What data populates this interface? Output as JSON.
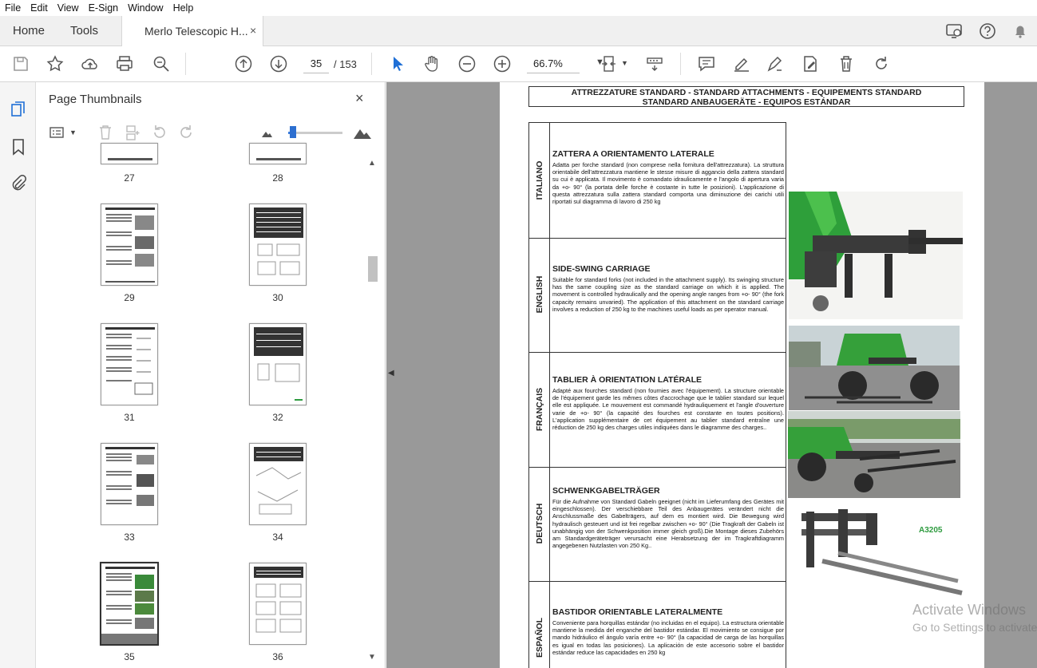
{
  "menu": [
    "File",
    "Edit",
    "View",
    "E-Sign",
    "Window",
    "Help"
  ],
  "tabs": {
    "home": "Home",
    "tools": "Tools",
    "document": "Merlo Telescopic H...",
    "close": "×"
  },
  "toolbar": {
    "page_current": "35",
    "page_total": "/ 153",
    "zoom": "66.7%"
  },
  "panel": {
    "title": "Page Thumbnails",
    "close": "×",
    "thumbnails": [
      {
        "num": "27"
      },
      {
        "num": "28"
      },
      {
        "num": "29"
      },
      {
        "num": "30"
      },
      {
        "num": "31"
      },
      {
        "num": "32"
      },
      {
        "num": "33"
      },
      {
        "num": "34"
      },
      {
        "num": "35",
        "selected": true
      },
      {
        "num": "36"
      }
    ]
  },
  "document": {
    "header_line1": "ATTREZZATURE STANDARD - STANDARD ATTACHMENTS - EQUIPEMENTS STANDARD",
    "header_line2": "STANDARD ANBAUGERÄTE - EQUIPOS ESTÁNDAR",
    "sections": [
      {
        "lang": "ITALIANO",
        "title": "ZATTERA A ORIENTAMENTO LATERALE",
        "body": "Adatta per forche standard (non comprese nella fornitura dell'attrezzatura). La struttura orientabile dell'attrezzatura mantiene le stesse misure di aggancio della zattera standard su cui è applicata. Il movimento è comandato idraulicamente e l'angolo di apertura varia da +o- 90° (la portata delle forche è costante in tutte le posizioni). L'applicazione di questa attrezzatura sulla zattera standard comporta una diminuzione dei carichi utili riportati sul diagramma di lavoro di 250 kg"
      },
      {
        "lang": "ENGLISH",
        "title": "SIDE-SWING CARRIAGE",
        "body": "Suitable for standard forks (not included in the attachment supply). Its swinging structure has the same coupling size as the standard carriage on which it is applied. The movement is controlled hydraulically and the opening angle ranges from +o- 90° (the fork capacity remains unvaried). The application of this attachment on the standard carriage involves a reduction of 250 kg to the machines useful loads as per operator manual."
      },
      {
        "lang": "FRANÇAIS",
        "title": "TABLIER À ORIENTATION LATÉRALE",
        "body": "Adapté aux fourches standard (non fournies avec l'équipement). La structure orientable de l'équipement garde les mêmes côtes d'accrochage que le tablier standard sur lequel elle est appliquée. Le mouvement est commandé hydrauliquement et l'angle d'ouverture varie de +o- 90° (la capacité des fourches est constante en toutes positions). L'application supplémentaire de cet équipement au tablier standard entraîne une réduction de 250 kg des charges utiles indiquées dans le diagramme des charges.."
      },
      {
        "lang": "DEUTSCH",
        "title": "SCHWENKGABELTRÄGER",
        "body": "Für die Aufnahme von Standard Gabeln geeignet (nicht im Lieferumfang des Gerätes mit eingeschlossen). Der verschiebbare Teil des Anbaugerätes verändert nicht die Anschlussmaße des Gabelträgers, auf dem es montiert wird. Die Bewegung wird hydraulisch gesteuert und ist frei regelbar zwischen +o- 90° (Die Tragkraft der Gabeln ist unabhängig von der Schwenkposition immer gleich groß).Die Montage dieses Zubehörs am Standardgeräteträger verursacht eine Herabsetzung der im Tragkraftdiagramm angegebenen Nutzlasten von 250 Kg.."
      },
      {
        "lang": "ESPAÑOL",
        "title": "BASTIDOR ORIENTABLE LATERALMENTE",
        "body": "Conveniente para horquillas estándar (no incluidas en el equipo). La estructura orientable mantiene la medida del enganche del bastidor estándar. El movimiento se consigue por mando hidráulico el ángulo varía entre +o- 90° (la capacidad de carga de las horquillas es igual en todas las posiciones). La aplicación de este accesorio sobre el bastidor estándar reduce las capacidades en 250 kg"
      }
    ],
    "product_code": "A3205"
  },
  "watermark": {
    "line1": "Activate Windows",
    "line2": "Go to Settings to activate"
  }
}
